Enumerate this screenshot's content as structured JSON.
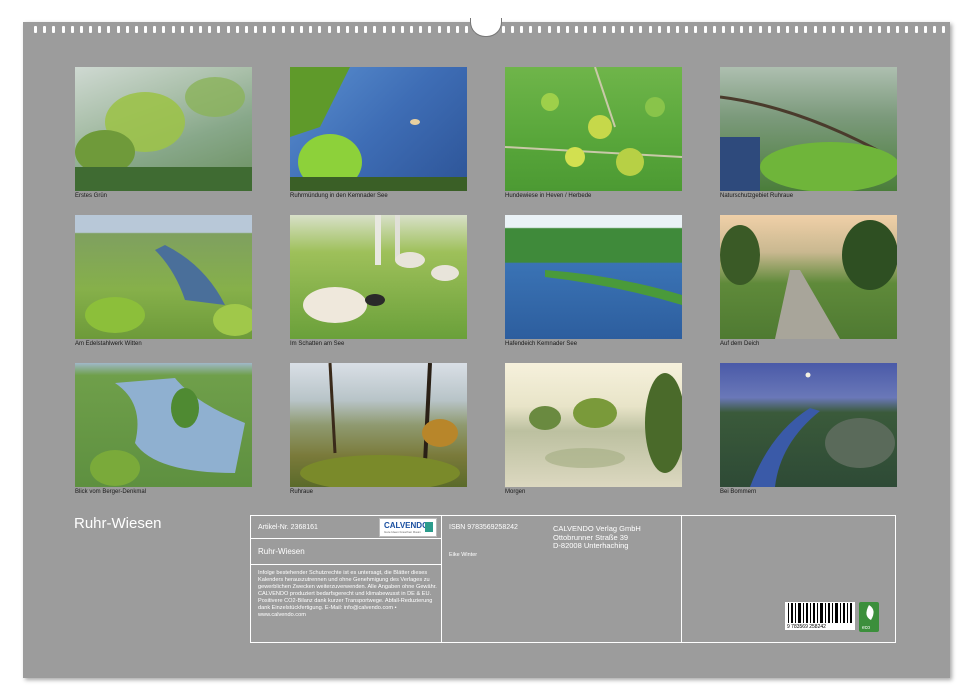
{
  "calendar_title": "Ruhr-Wiesen",
  "photos": [
    {
      "caption": "Erstes Grün"
    },
    {
      "caption": "Ruhrmündung in den Kemnader See"
    },
    {
      "caption": "Hundewiese in Heven / Herbede"
    },
    {
      "caption": "Naturschutzgebiet Ruhraue"
    },
    {
      "caption": "Am Edelstahlwerk Witten"
    },
    {
      "caption": "Im Schatten am See"
    },
    {
      "caption": "Hafendeich Kemnader See"
    },
    {
      "caption": "Auf dem Deich"
    },
    {
      "caption": "Blick vom Berger-Denkmal"
    },
    {
      "caption": "Ruhraue"
    },
    {
      "caption": "Morgen"
    },
    {
      "caption": "Bei Bommern"
    }
  ],
  "info": {
    "article_no": "Artikel-Nr. 2368161",
    "product_title": "Ruhr-Wiesen",
    "legal_text": "Infolge bestehender Schutzrechte ist es untersagt, die Blätter dieses Kalenders herauszutrennen und ohne Genehmigung des Verlages zu gewerblichen Zwecken weiterzuverwenden. Alle Angaben ohne Gewähr. CALVENDO produziert bedarfsgerecht und klimabewusst in DE & EU. Positivere CO2-Bilanz dank kurzer Transportwege. Abfall-Reduzierung dank Einzelstückfertigung. E-Mail: info@calvendo.com • www.calvendo.com",
    "isbn": "ISBN 9783569258242",
    "author": "Eike Winter",
    "publisher_name": "CALVENDO Verlag GmbH",
    "publisher_street": "Ottobrunner Straße 39",
    "publisher_city": "D-82008 Unterhaching",
    "logo_name": "CALVENDO",
    "logo_sub": "Gute Ideen brauchen Raum",
    "barcode_digits": "9 783569 258242",
    "eco_label": "eco"
  }
}
